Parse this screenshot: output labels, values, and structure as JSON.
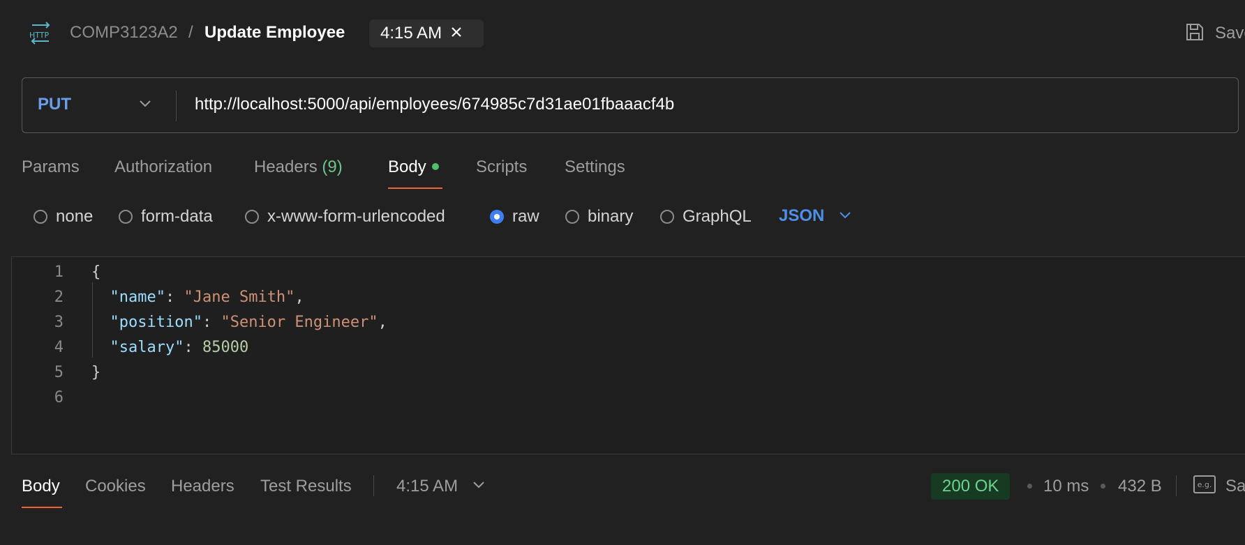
{
  "header": {
    "collection": "COMP3123A2",
    "separator": "/",
    "request_title": "Update Employee",
    "tab_time": "4:15 AM",
    "save_label": "Save"
  },
  "request": {
    "method": "PUT",
    "url": "http://localhost:5000/api/employees/674985c7d31ae01fbaaacf4b"
  },
  "request_tabs": {
    "params": "Params",
    "authorization": "Authorization",
    "headers": "Headers",
    "headers_count": "(9)",
    "body": "Body",
    "scripts": "Scripts",
    "settings": "Settings"
  },
  "body_types": {
    "none": "none",
    "form_data": "form-data",
    "urlencoded": "x-www-form-urlencoded",
    "raw": "raw",
    "binary": "binary",
    "graphql": "GraphQL",
    "language": "JSON",
    "selected": "raw"
  },
  "editor": {
    "line_numbers": [
      "1",
      "2",
      "3",
      "4",
      "5",
      "6"
    ],
    "open_brace": "{",
    "close_brace": "}",
    "key_name": "\"name\"",
    "val_name": "\"Jane Smith\"",
    "key_position": "\"position\"",
    "val_position": "\"Senior Engineer\"",
    "key_salary": "\"salary\"",
    "val_salary": "85000"
  },
  "response": {
    "tabs": {
      "body": "Body",
      "cookies": "Cookies",
      "headers": "Headers",
      "test_results": "Test Results"
    },
    "time_label": "4:15 AM",
    "status": "200 OK",
    "duration": "10 ms",
    "size": "432 B",
    "example_icon_text": "e.g.",
    "save_label": "Save"
  },
  "colors": {
    "background": "#212121",
    "accent_orange": "#e8663a",
    "method_blue": "#6b9ee8",
    "status_green": "#6cd391",
    "radio_blue": "#3d7ef0"
  }
}
